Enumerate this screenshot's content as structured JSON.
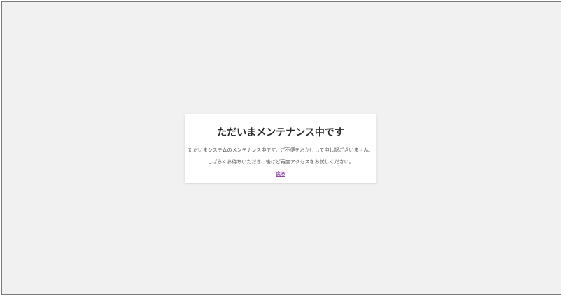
{
  "maintenance": {
    "title": "ただいまメンテナンス中です",
    "message_line1": "ただいまシステムのメンテナンス中です。ご不便をおかけして申し訳ございません。",
    "message_line2": "しばらくお待ちいただき、後ほど再度アクセスをお試しください。",
    "back_link_label": "戻る"
  },
  "colors": {
    "background": "#f1f1f1",
    "card": "#ffffff",
    "title_text": "#2b2b2b",
    "body_text": "#555555",
    "link": "#8e44ad"
  }
}
